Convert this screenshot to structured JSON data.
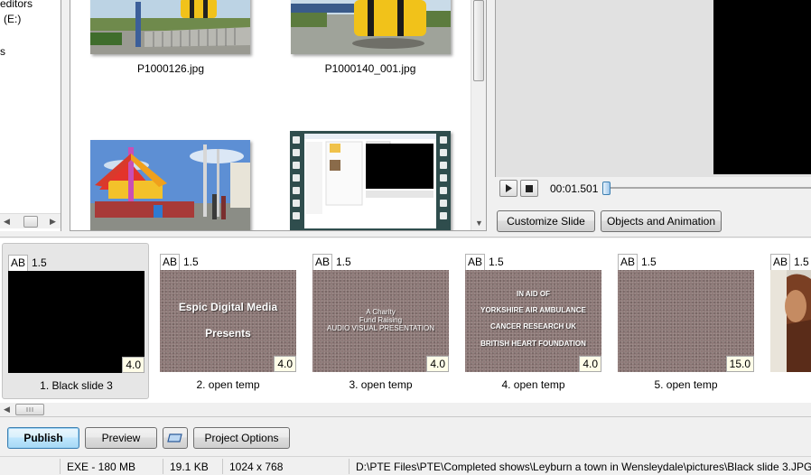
{
  "folder_tree": {
    "items": [
      "editors",
      "(E:)",
      "s"
    ]
  },
  "file_browser": {
    "files": [
      {
        "name": "P1000126.jpg"
      },
      {
        "name": "P1000140_001.jpg"
      },
      {
        "name": ""
      },
      {
        "name": ""
      }
    ]
  },
  "player": {
    "time": "00:01.501",
    "position_fraction": 0.0
  },
  "buttons": {
    "customize_slide": "Customize Slide",
    "objects_and_animation": "Objects and Animation",
    "publish": "Publish",
    "preview": "Preview",
    "project_options": "Project Options"
  },
  "slides": [
    {
      "badge": "AB",
      "transition": "1.5",
      "duration": "4.0",
      "label": "1. Black slide 3",
      "lines": []
    },
    {
      "badge": "AB",
      "transition": "1.5",
      "duration": "4.0",
      "label": "2. open temp",
      "lines": [
        "Espic Digital Media",
        "Presents"
      ]
    },
    {
      "badge": "AB",
      "transition": "1.5",
      "duration": "4.0",
      "label": "3. open temp",
      "lines": [
        "A Charity",
        "Fund Raising",
        "AUDIO VISUAL PRESENTATION"
      ]
    },
    {
      "badge": "AB",
      "transition": "1.5",
      "duration": "4.0",
      "label": "4. open temp",
      "lines": [
        "IN AID OF",
        "YORKSHIRE AIR AMBULANCE",
        "CANCER RESEARCH UK",
        "BRITISH HEART FOUNDATION"
      ]
    },
    {
      "badge": "AB",
      "transition": "1.5",
      "duration": "15.0",
      "label": "5. open temp",
      "lines": []
    },
    {
      "badge": "AB",
      "transition": "1.5",
      "duration": "",
      "label": "",
      "lines": []
    }
  ],
  "status_bar": {
    "exe_size": "EXE - 180 MB",
    "file_size": "19.1 KB",
    "dimensions": "1024 x 768",
    "path": "D:\\PTE Files\\PTE\\Completed shows\\Leyburn a town in Wensleydale\\pictures\\Black slide 3.JPG"
  },
  "colors": {
    "selection_bg": "#e6e6e6",
    "slide_texture": "#8a7573",
    "accent_blue": "#3c7fb1"
  }
}
